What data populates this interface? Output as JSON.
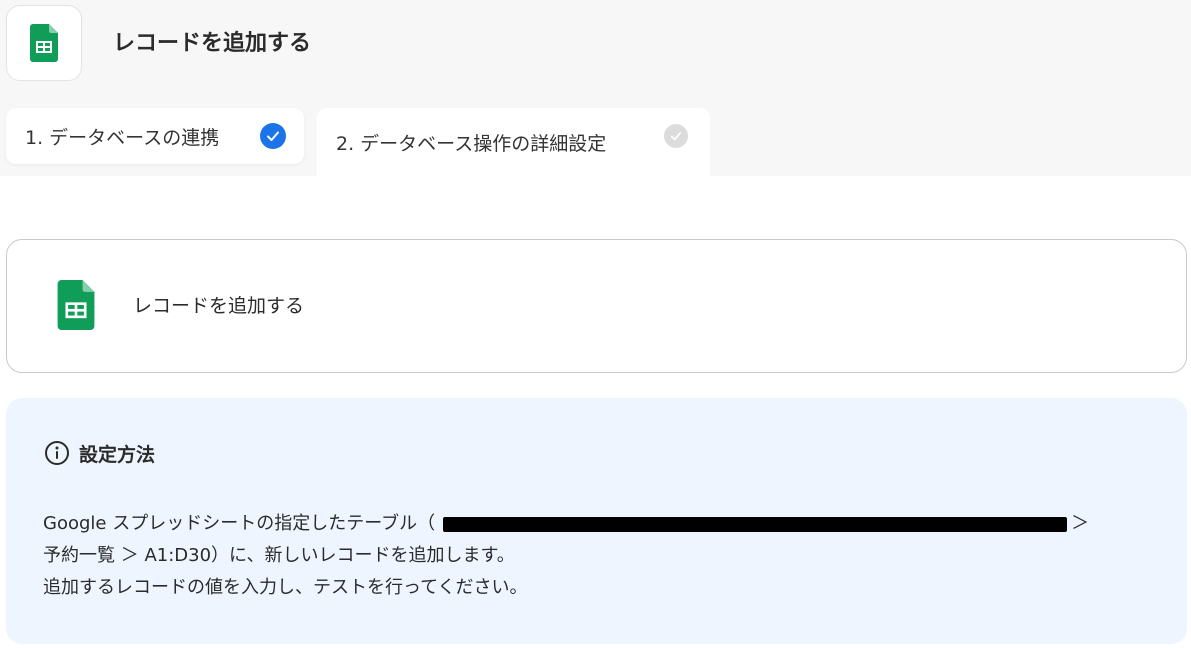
{
  "header": {
    "app_icon": "google-sheets-icon",
    "title": "レコードを追加する"
  },
  "tabs": [
    {
      "label": "1. データベースの連携",
      "status": "completed",
      "status_icon": "check-circle-icon",
      "status_color": "#1b74e8"
    },
    {
      "label": "2. データベース操作の詳細設定",
      "status": "pending",
      "status_icon": "check-circle-icon",
      "status_color": "#dcdcdc"
    }
  ],
  "action": {
    "icon": "google-sheets-icon",
    "label": "レコードを追加する"
  },
  "info": {
    "icon": "info-icon",
    "title": "設定方法",
    "line1_prefix": "Google スプレッドシートの指定したテーブル（",
    "line1_suffix": "＞",
    "line2": "予約一覧 ＞ A1:D30）に、新しいレコードを追加します。",
    "line3": "追加するレコードの値を入力し、テストを行ってください。"
  },
  "colors": {
    "accent": "#1b74e8",
    "sheets_green": "#0f9d58",
    "info_background": "#eef5fe"
  }
}
